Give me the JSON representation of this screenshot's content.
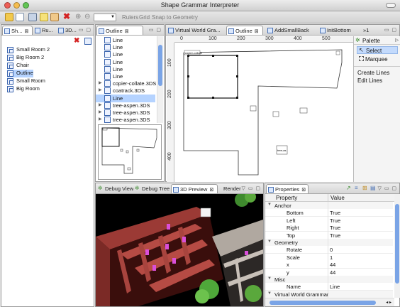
{
  "window": {
    "title": "Shape Grammar Interpreter"
  },
  "toolbar": {
    "zoom_value": "",
    "rulers_label": "Rulers",
    "grid_label": "Grid",
    "snap_label": "Snap to Geometry"
  },
  "left_panel": {
    "tabs": [
      "Sh...",
      "Ru...",
      "3D..."
    ],
    "rooms": [
      "Small Room 2",
      "Big Room 2",
      "Chair",
      "Outline",
      "Small Room",
      "Big Room"
    ],
    "selected": "Outline"
  },
  "outline_panel": {
    "tab": "Outline",
    "items": [
      {
        "label": "Line",
        "expand": false
      },
      {
        "label": "Line",
        "expand": false
      },
      {
        "label": "Line",
        "expand": false
      },
      {
        "label": "Line",
        "expand": false
      },
      {
        "label": "Line",
        "expand": false
      },
      {
        "label": "Line",
        "expand": false
      },
      {
        "label": "copier-collate.3DS",
        "expand": true
      },
      {
        "label": "coatrack.3DS",
        "expand": true
      },
      {
        "label": "Line",
        "expand": false,
        "selected": true
      },
      {
        "label": "tree-aspen.3DS",
        "expand": true
      },
      {
        "label": "tree-aspen.3DS",
        "expand": true
      },
      {
        "label": "tree-aspen.3DS",
        "expand": true
      }
    ]
  },
  "editor": {
    "tabs": [
      "Virtual World Gra...",
      "Outline",
      "AddSmallBack",
      "InitBottom",
      "»1"
    ],
    "ruler_h": [
      "0",
      "100",
      "200",
      "300",
      "400",
      "500"
    ],
    "ruler_v": [
      "100",
      "200",
      "300",
      "400"
    ],
    "canvas_labels": {
      "copier": "copier-collate",
      "tree": "tree-as"
    }
  },
  "palette": {
    "title": "Palette",
    "tools": [
      "Select",
      "Marquee"
    ],
    "actions": [
      "Create Lines",
      "Edit Lines"
    ]
  },
  "bottom_left": {
    "tabs": [
      "Debug View",
      "Debug Tree",
      "3D Preview",
      "Render"
    ]
  },
  "properties": {
    "title": "Properties",
    "headers": [
      "Property",
      "Value"
    ],
    "rows": [
      {
        "name": "Anchor",
        "value": "",
        "group": true
      },
      {
        "name": "Bottom",
        "value": "True"
      },
      {
        "name": "Left",
        "value": "True"
      },
      {
        "name": "Right",
        "value": "True"
      },
      {
        "name": "Top",
        "value": "True"
      },
      {
        "name": "Geometry",
        "value": "",
        "group": true
      },
      {
        "name": "Rotate",
        "value": "0"
      },
      {
        "name": "Scale",
        "value": "1"
      },
      {
        "name": "x",
        "value": "44"
      },
      {
        "name": "y",
        "value": "44"
      },
      {
        "name": "Misc",
        "value": "",
        "group": true
      },
      {
        "name": "Name",
        "value": "Line"
      },
      {
        "name": "Virtual World Grammar",
        "value": "",
        "group": true
      }
    ]
  }
}
